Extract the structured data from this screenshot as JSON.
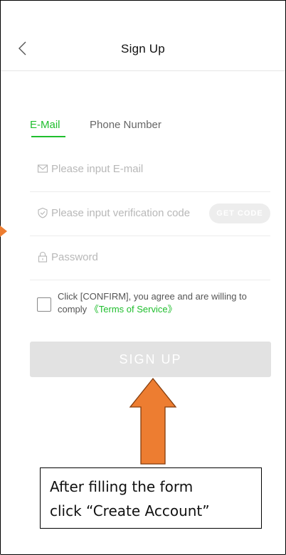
{
  "header": {
    "title": "Sign Up",
    "back_icon": "chevron-left-icon"
  },
  "tabs": [
    {
      "label": "E-Mail",
      "active": true
    },
    {
      "label": "Phone Number",
      "active": false
    }
  ],
  "form": {
    "email": {
      "placeholder": "Please input E-mail",
      "value": "",
      "icon": "mail-icon"
    },
    "code": {
      "placeholder": "Please input verification code",
      "value": "",
      "icon": "shield-check-icon",
      "button_label": "GET CODE"
    },
    "password": {
      "placeholder": "Password",
      "value": "",
      "icon": "lock-icon"
    },
    "agree": {
      "text_line": "Click [CONFIRM], you agree and are willing to comply ",
      "link_label": "《Terms of Service》",
      "checked": false
    },
    "submit_label": "SIGN UP"
  },
  "annotation": {
    "line1": "After filling the form",
    "line2": "click “Create Account”"
  },
  "colors": {
    "accent": "#1fbe2d",
    "button_disabled": "#e2e2e2",
    "annotation_arrow": "#ed7d31"
  }
}
